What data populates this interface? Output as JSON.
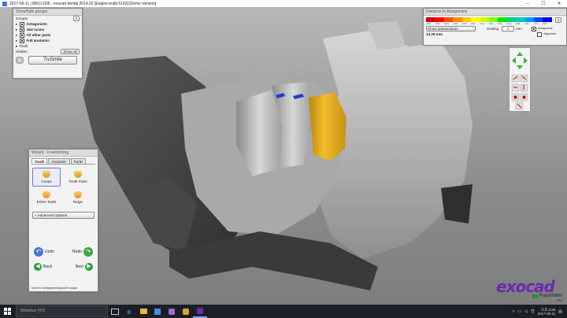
{
  "window": {
    "title": "2017-06-11_00011-005 - exocad dental 2014.02 [Engine build 5163] [Demo Version]",
    "min": "–",
    "max": "☐",
    "close": "✕"
  },
  "showhide": {
    "header": "Show/hide groups",
    "groups_label": "Groups",
    "help": "?",
    "items": [
      {
        "label": "Antagonists",
        "checked": true
      },
      {
        "label": "Jaw scans",
        "checked": true
      },
      {
        "label": "All other parts",
        "checked": true
      },
      {
        "label": "Full anatomic",
        "checked": true
      }
    ],
    "tooth_label": "Tooth",
    "hidden_label": "Hidden",
    "show_all": "Show all",
    "trusmile": "TruSmile"
  },
  "distance": {
    "header": "Distance to Antagonists",
    "ticks": [
      "-0.81",
      "-0.61",
      "-0.41",
      "-0.21",
      "-0.01",
      "0.01",
      "0.11",
      "0.21",
      "0.31",
      "0.41",
      "0.51",
      "0.61",
      "0.71",
      "0.81"
    ],
    "show_intersections": "Show intersections",
    "scaling_label": "Scaling",
    "scaling_value": "1",
    "mm": "mm",
    "distance_value": "13.28 mm",
    "antagonists": "Antagonists",
    "adjacents": "Adjacents",
    "help": "?",
    "colors": [
      "#cc0000",
      "#ff0000",
      "#ff4a00",
      "#ff8c00",
      "#ffc800",
      "#ffff00",
      "#c8ff00",
      "#7aff00",
      "#00e600",
      "#00d27a",
      "#00c8c8",
      "#0096ff",
      "#0046ff",
      "#0000e6"
    ]
  },
  "wizard": {
    "header": "Wizard - Freeforming",
    "tabs": [
      "Tooth",
      "Anatomic",
      "Portic"
    ],
    "tools": [
      "Cusps",
      "Tooth Parts",
      "Entire Tooth",
      "Ridge"
    ],
    "advanced": "+ Advanced Options",
    "undo": "Undo",
    "redo": "Redo",
    "back": "Back",
    "next": "Next",
    "footer": "Next for antagonist/adjacent adapt"
  },
  "brand": {
    "name": "exocad",
    "sub": "Fraunhofer",
    "tag": "IGD"
  },
  "taskbar": {
    "search_placeholder": "Windows 검색",
    "lang": "한",
    "time": "오후 2:58",
    "date": "2017-06-11"
  }
}
